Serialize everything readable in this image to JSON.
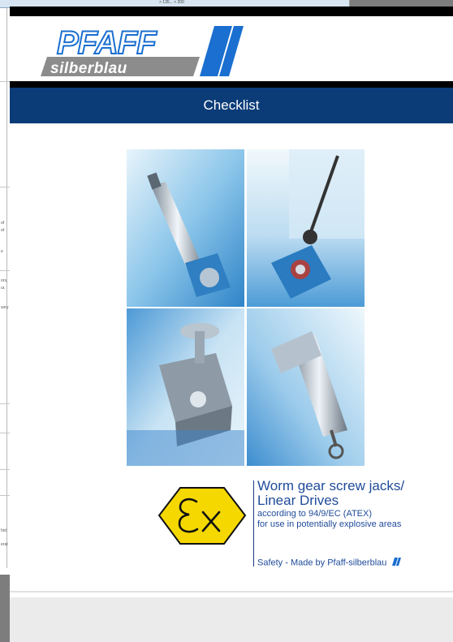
{
  "background_document": {
    "header_text": "> 135... < 200",
    "fragments": [
      "of",
      "of",
      "e",
      "ors,",
      "ur,",
      "sory",
      "hicl",
      "erat"
    ]
  },
  "brand": {
    "logo_main": "PFAFF",
    "logo_sub": "silberblau"
  },
  "title": "Checklist",
  "photos": [
    {
      "name": "photo-jack-tilted"
    },
    {
      "name": "photo-jack-vertical"
    },
    {
      "name": "photo-gearbox-flange"
    },
    {
      "name": "photo-linear-drive"
    }
  ],
  "product": {
    "line1": "Worm gear screw jacks/",
    "line2": "Linear Drives",
    "line3": "according to 94/9/EC (ATEX)",
    "line4": "for use in potentially explosive areas",
    "tagline": "Safety - Made by Pfaff-silberblau"
  },
  "colors": {
    "title_band": "#0b3c78",
    "product_text": "#1f4b9a",
    "ex_symbol": "#f5d800",
    "logo_blue": "#1a6fd0",
    "logo_grey": "#8c8c8c"
  }
}
